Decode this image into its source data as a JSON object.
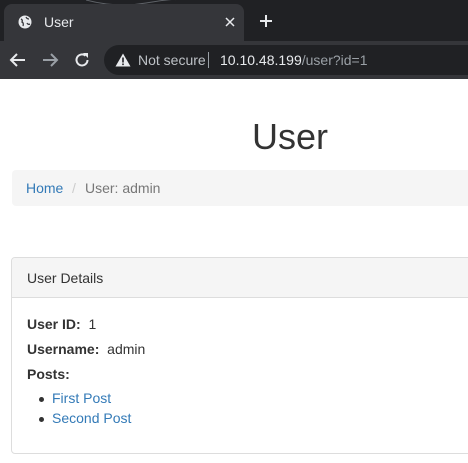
{
  "browser": {
    "tab_title": "User",
    "security_label": "Not secure",
    "url_host": "10.10.48.199",
    "url_path": "/user?id=1"
  },
  "page": {
    "title": "User",
    "breadcrumb": {
      "home": "Home",
      "separator": "/",
      "current": "User: admin"
    },
    "panel": {
      "heading": "User Details",
      "user_id_label": "User ID:",
      "user_id_value": "1",
      "username_label": "Username:",
      "username_value": "admin",
      "posts_label": "Posts:",
      "posts": [
        "First Post",
        "Second Post"
      ]
    }
  },
  "colors": {
    "link": "#337ab7",
    "chrome_dark": "#202124",
    "chrome_tab": "#35363a"
  }
}
